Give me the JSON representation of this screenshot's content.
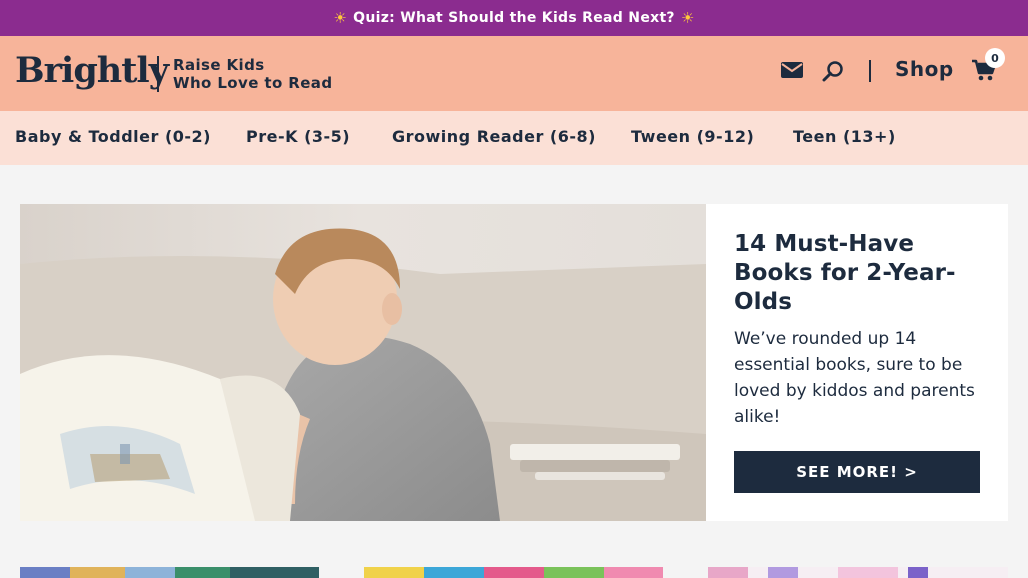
{
  "promo": {
    "text": "Quiz: What Should the Kids Read Next?",
    "icon": "sun-icon",
    "color": "#8b2c8f"
  },
  "header": {
    "logo": "Brightly",
    "tagline_line1": "Raise Kids",
    "tagline_line2": "Who Love to Read",
    "shop_label": "Shop",
    "cart_count": "0",
    "icons": [
      "mail-icon",
      "search-icon",
      "cart-icon"
    ],
    "background": "#f7b49a"
  },
  "nav": {
    "items": [
      {
        "label": "Baby & Toddler (0-2)"
      },
      {
        "label": "Pre-K (3-5)"
      },
      {
        "label": "Growing Reader (6-8)"
      },
      {
        "label": "Tween (9-12)"
      },
      {
        "label": "Teen (13+)"
      }
    ]
  },
  "hero": {
    "title": "14 Must-Have Books for 2-Year-Olds",
    "description": "We’ve rounded up 14 essential books, sure to be loved by kiddos and parents alike!",
    "button_label": "SEE MORE! >"
  }
}
